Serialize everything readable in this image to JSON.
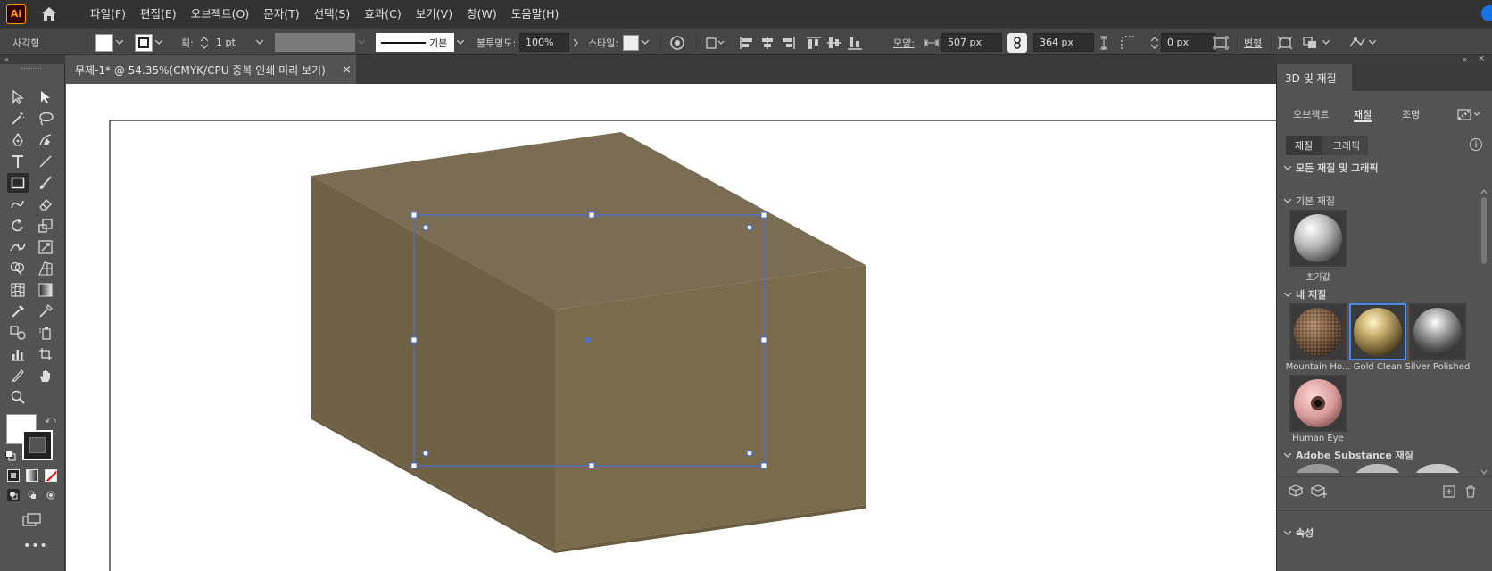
{
  "app": {
    "logo_text": "Ai",
    "brand_color": "#ff9a00"
  },
  "menus": [
    "파일(F)",
    "편집(E)",
    "오브젝트(O)",
    "문자(T)",
    "선택(S)",
    "효과(C)",
    "보기(V)",
    "창(W)",
    "도움말(H)"
  ],
  "control_bar": {
    "shape_label": "사각형",
    "stroke_label": "획:",
    "stroke_value": "1 pt",
    "brush_label": "기본",
    "opacity_label": "불투명도:",
    "opacity_value": "100%",
    "style_label": "스타일:",
    "shape_mode_label": "모양:",
    "width_value": "507 px",
    "height_value": "364 px",
    "corner_value": "0 px",
    "transform_label": "변형"
  },
  "document_tab": {
    "title": "무제-1* @ 54.35%(CMYK/CPU 중복 인쇄 미리 보기)",
    "close": "×"
  },
  "panel": {
    "title": "3D 및 재질",
    "tabs": [
      "오브젝트",
      "재질",
      "조명"
    ],
    "active_tab": "재질",
    "subtabs": [
      "재질",
      "그래픽"
    ],
    "active_subtab": "재질",
    "sections": {
      "all": "모든 재질 및 그래픽",
      "basic": "기본 재질",
      "mine": "내 재질",
      "substance": "Adobe Substance 재질",
      "properties": "속성"
    },
    "basic_materials": [
      {
        "label": "초기값"
      }
    ],
    "my_materials": [
      {
        "label": "Mountain Ho..."
      },
      {
        "label": "Gold Clean",
        "selected": true
      },
      {
        "label": "Silver Polished"
      },
      {
        "label": "Human Eye"
      }
    ]
  },
  "colors": {
    "selection": "#4a6fd8",
    "box_top": "#7b6d53",
    "box_left": "#6e6144",
    "box_front": "#7a6b4c"
  }
}
